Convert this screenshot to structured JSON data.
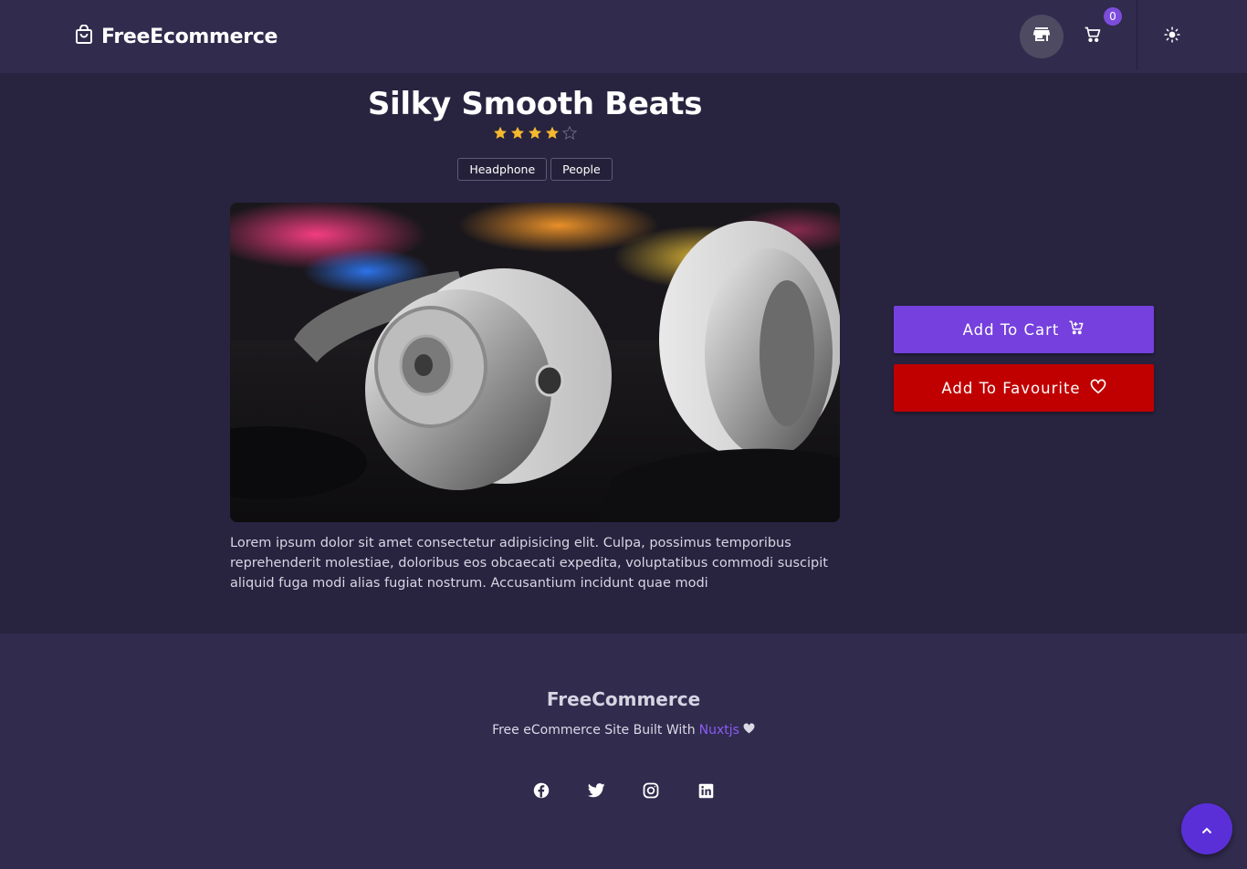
{
  "header": {
    "brand": "FreeEcommerce",
    "cart_count": "0"
  },
  "product": {
    "title": "Silky Smooth Beats",
    "rating": 4,
    "rating_max": 5,
    "tags": [
      "Headphone",
      "People"
    ],
    "description": "Lorem ipsum dolor sit amet consectetur adipisicing elit. Culpa, possimus temporibus reprehenderit molestiae, doloribus eos obcaecati expedita, voluptatibus commodi suscipit aliquid fuga modi alias fugiat nostrum. Accusantium incidunt quae modi"
  },
  "actions": {
    "add_to_cart": "Add To Cart",
    "add_to_favourite": "Add To Favourite"
  },
  "footer": {
    "brand": "FreeCommerce",
    "tagline": "Free eCommerce Site Built With",
    "tagline_link": "Nuxtjs",
    "socials": [
      "facebook-icon",
      "twitter-icon",
      "instagram-icon",
      "linkedin-icon"
    ]
  },
  "colors": {
    "accent": "#7540dd",
    "danger": "#c00000",
    "star": "#f5b82e",
    "bg": "#28233f",
    "header_bg": "#312b4d"
  }
}
